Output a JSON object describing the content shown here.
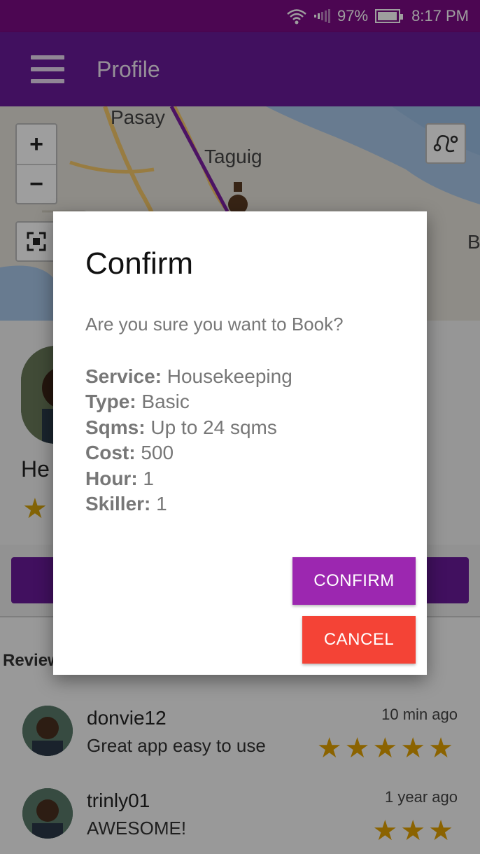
{
  "status_bar": {
    "battery": "97%",
    "time": "8:17 PM",
    "battery_level": 0.97
  },
  "app_bar": {
    "title": "Profile",
    "menu_icon": "hamburger-menu-icon"
  },
  "map": {
    "labels": [
      "Pasay",
      "Taguig",
      "B"
    ],
    "zoom_in": "+",
    "zoom_out": "−"
  },
  "profile": {
    "name": "He",
    "star": "★"
  },
  "reviews": {
    "title": "Review",
    "items": [
      {
        "user": "donvie12",
        "text": "Great app easy to use",
        "time": "10 min ago",
        "stars": "★★★★★",
        "rating": 5
      },
      {
        "user": "trinly01",
        "text": "AWESOME!",
        "time": "1 year ago",
        "stars": "★★★",
        "rating": 3
      }
    ]
  },
  "dialog": {
    "title": "Confirm",
    "message": "Are you sure you want to Book?",
    "details": [
      {
        "label": "Service:",
        "value": " Housekeeping"
      },
      {
        "label": "Type:",
        "value": " Basic"
      },
      {
        "label": "Sqms:",
        "value": " Up to 24 sqms"
      },
      {
        "label": "Cost:",
        "value": " 500"
      },
      {
        "label": "Hour:",
        "value": " 1"
      },
      {
        "label": "Skiller:",
        "value": " 1"
      }
    ],
    "confirm_label": "CONFIRM",
    "cancel_label": "CANCEL"
  },
  "colors": {
    "status_bar": "#7b0a85",
    "app_bar": "#6a1b9a",
    "confirm": "#9c27b0",
    "cancel": "#f44336",
    "star": "#e0a100"
  }
}
